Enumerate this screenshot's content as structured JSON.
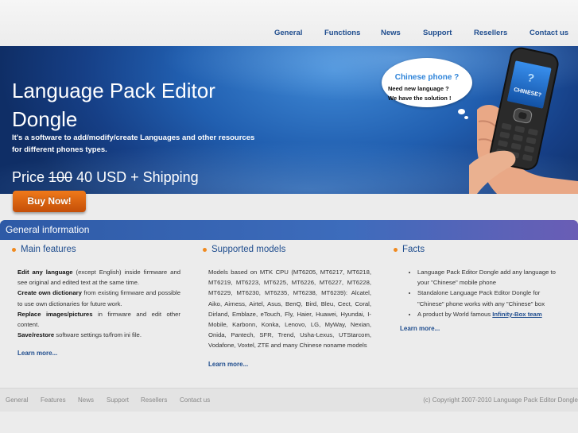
{
  "nav": {
    "items": [
      "General",
      "Functions",
      "News",
      "Support",
      "Resellers",
      "Contact us"
    ]
  },
  "hero": {
    "title_line1": "Language Pack Editor",
    "title_line2": "Dongle",
    "description": "It's a software to add/modify/create Languages and other resources for different phones types.",
    "price_prefix": "Price",
    "price_old": "100",
    "price_new": "40 USD + Shipping",
    "bubble_question": "Chinese phone ?",
    "bubble_line1": "Need new language ?",
    "bubble_line2": "We have the solution !",
    "phone_screen_text": "CHINESE?",
    "buy_label": "Buy Now!"
  },
  "info_bar": {
    "title": "General information"
  },
  "columns": {
    "main": {
      "heading": "Main features",
      "p1_bold": "Edit any language",
      "p1_rest": " (except English) inside firmware and see original and edited text at the same time.",
      "p2_bold": "Create own dictionary",
      "p2_rest": " from existing firmware and possible to use own dictionaries for future work.",
      "p3_bold": "Replace images/pictures",
      "p3_rest": " in firmware and edit other content.",
      "p4_bold": "Save/restore",
      "p4_rest": " software settings to/from ini file.",
      "more": "Learn more..."
    },
    "models": {
      "heading": "Supported models",
      "text": "Models based on MTK CPU (MT6205, MT6217, MT6218, MT6219, MT6223, MT6225, MT6226, MT6227, MT6228, MT6229, MT6230, MT6235, MT6238, MT6239): Alcatel, Aiko, Airness, Airtel, Asus, BenQ, Bird, Bleu, Cect, Coral, Dirland, Emblaze, eTouch, Fly, Haier, Huawei, Hyundai, I-Mobile, Karbonn, Konka, Lenovo, LG, MyWay, Nexian, Onida, Pantech, SFR, Trend, Usha-Lexus, UTStarcom, Vodafone, Voxtel, ZTE and many Chinese noname models",
      "more": "Learn more..."
    },
    "facts": {
      "heading": "Facts",
      "item1": "Language Pack Editor Dongle add any language to your \"Chinese\" mobile phone",
      "item2": "Standalone Language Pack Editor Dongle for \"Chinese\" phone works with any \"Chinese\" box",
      "item3_prefix": "A product by World famous ",
      "item3_link": "Infinity-Box team",
      "more": "Learn more..."
    }
  },
  "footer": {
    "links": [
      "General",
      "Features",
      "News",
      "Support",
      "Resellers",
      "Contact us"
    ],
    "copyright": "(c) Copyright 2007-2010 Language Pack Editor Dongle"
  },
  "colors": {
    "accent": "#1f4d8e",
    "button_orange": "#e06a12",
    "bullet_orange": "#f08a20",
    "hero_blue": "#215fb0"
  }
}
